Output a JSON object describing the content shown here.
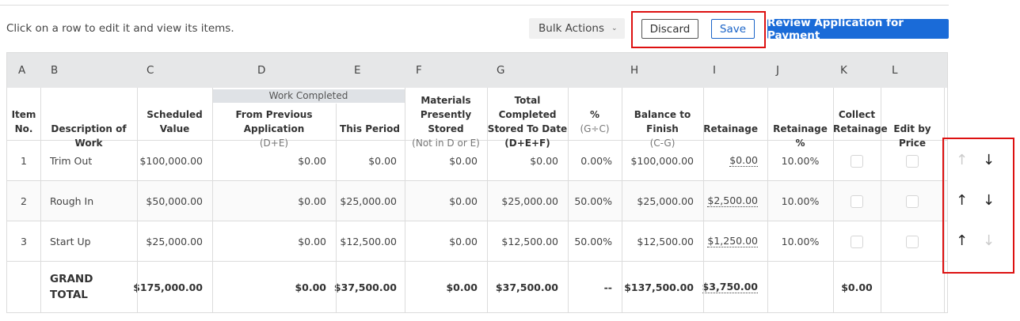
{
  "hint": "Click on a row to edit it and view its items.",
  "toolbar": {
    "bulk_label": "Bulk Actions",
    "discard_label": "Discard",
    "save_label": "Save",
    "review_label": "Review Application for Payment"
  },
  "colors": {
    "primary": "#1a6bd8",
    "highlight": "#dd1111"
  },
  "column_letters": [
    "A",
    "B",
    "C",
    "D",
    "E",
    "F",
    "G",
    "H",
    "I",
    "J",
    "K",
    "L"
  ],
  "headers": {
    "work_completed": "Work Completed",
    "item_no": "Item No.",
    "item_no_1": "Item",
    "item_no_2": "No.",
    "description": "Description of Work",
    "scheduled_1": "Scheduled",
    "scheduled_2": "Value",
    "from_prev_1": "From Previous Application",
    "from_prev_2": "(D+E)",
    "this_period": "This Period",
    "materials_1": "Materials",
    "materials_2": "Presently Stored",
    "materials_3": "(Not in D or E)",
    "total_1": "Total Completed",
    "total_2": "Stored To Date",
    "total_3": "(D+E+F)",
    "pct_1": "%",
    "pct_2": "(G÷C)",
    "balance_1": "Balance to Finish",
    "balance_2": "(C-G)",
    "retainage": "Retainage",
    "retainage_pct": "Retainage %",
    "collect_1": "Collect",
    "collect_2": "Retainage",
    "edit_by_price": "Edit by Price"
  },
  "rows": [
    {
      "no": "1",
      "desc": "Trim Out",
      "scheduled": "$100,000.00",
      "prev": "$0.00",
      "period": "$0.00",
      "materials": "$0.00",
      "total": "$0.00",
      "pct": "0.00%",
      "balance": "$100,000.00",
      "retainage": "$0.00",
      "ret_pct": "10.00%",
      "up_enabled": false,
      "down_enabled": true
    },
    {
      "no": "2",
      "desc": "Rough In",
      "scheduled": "$50,000.00",
      "prev": "$0.00",
      "period": "$25,000.00",
      "materials": "$0.00",
      "total": "$25,000.00",
      "pct": "50.00%",
      "balance": "$25,000.00",
      "retainage": "$2,500.00",
      "ret_pct": "10.00%",
      "up_enabled": true,
      "down_enabled": true
    },
    {
      "no": "3",
      "desc": "Start Up",
      "scheduled": "$25,000.00",
      "prev": "$0.00",
      "period": "$12,500.00",
      "materials": "$0.00",
      "total": "$12,500.00",
      "pct": "50.00%",
      "balance": "$12,500.00",
      "retainage": "$1,250.00",
      "ret_pct": "10.00%",
      "up_enabled": true,
      "down_enabled": false
    }
  ],
  "grand_total": {
    "label_1": "GRAND",
    "label_2": "TOTAL",
    "scheduled": "$175,000.00",
    "prev": "$0.00",
    "period": "$37,500.00",
    "materials": "$0.00",
    "total": "$37,500.00",
    "pct": "--",
    "balance": "$137,500.00",
    "retainage": "$3,750.00",
    "collect": "$0.00"
  },
  "icons": {
    "up": "arrow-up-icon",
    "down": "arrow-down-icon",
    "chevron": "chevron-down-icon"
  }
}
